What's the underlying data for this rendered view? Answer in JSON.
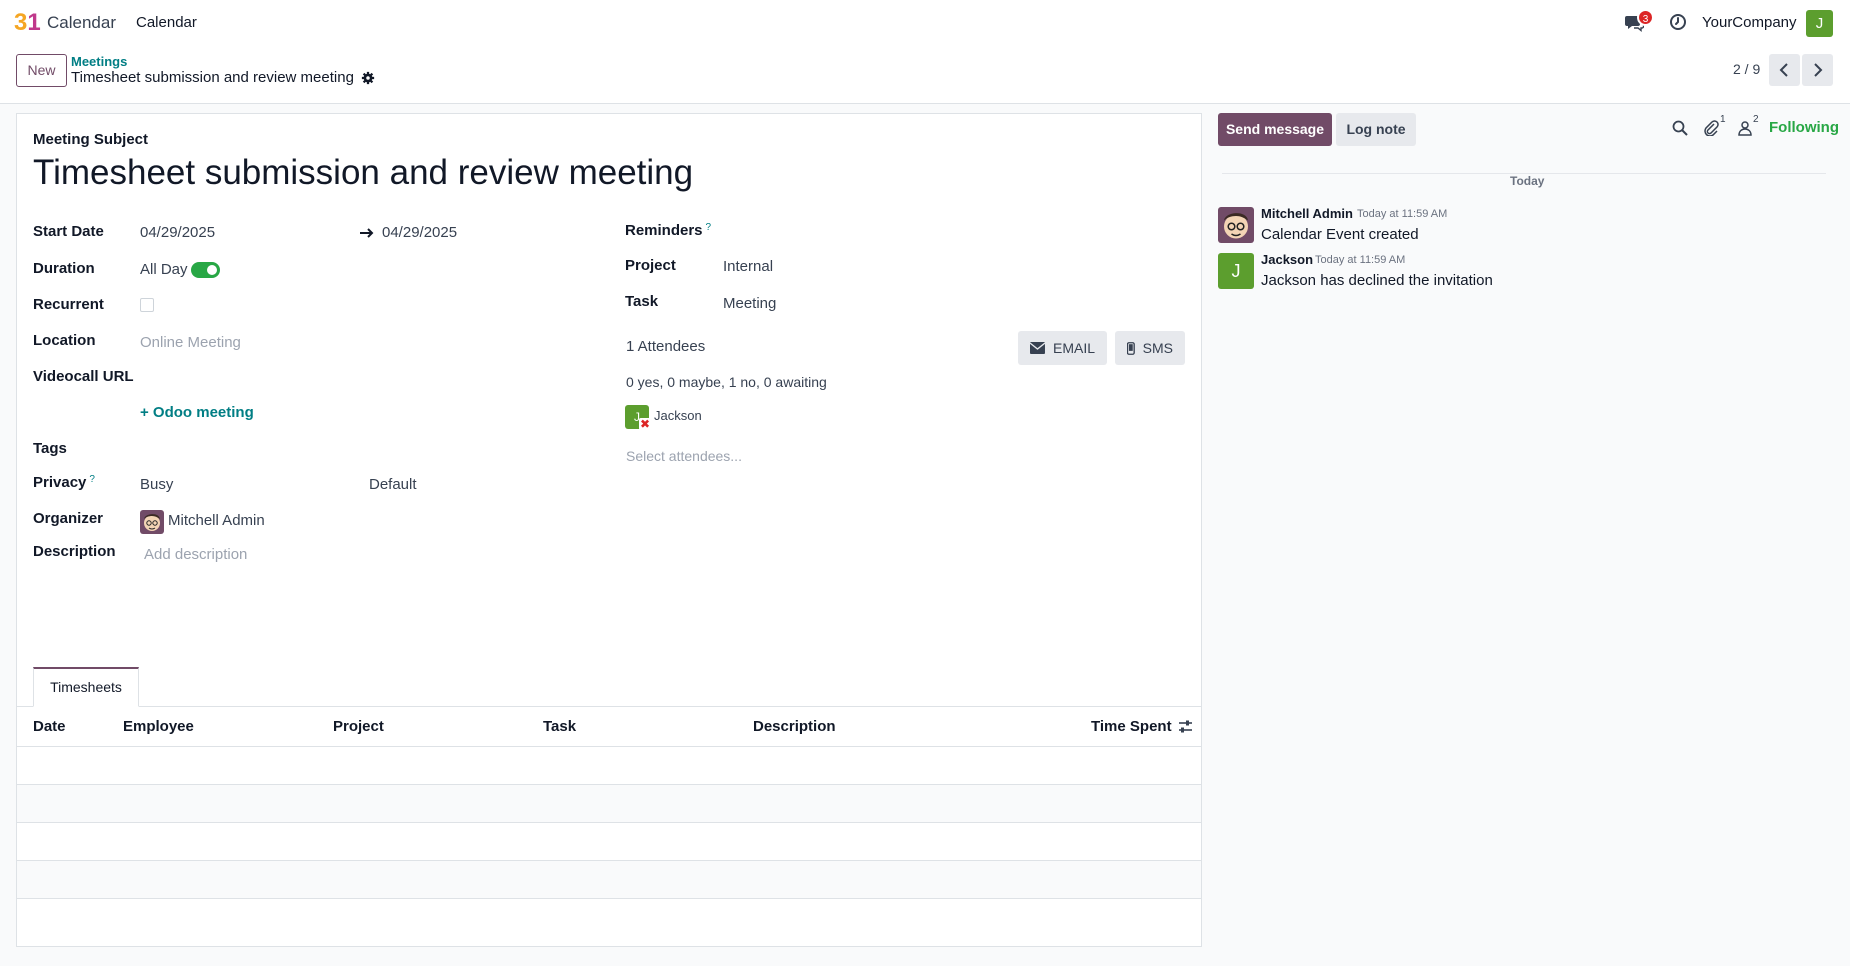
{
  "nav": {
    "app_name": "Calendar",
    "menu_calendar": "Calendar",
    "message_badge": "3",
    "company": "YourCompany",
    "user_initial": "J"
  },
  "control": {
    "new_label": "New",
    "breadcrumb_parent": "Meetings",
    "breadcrumb_current": "Timesheet submission and review meeting",
    "pager": "2 / 9"
  },
  "form": {
    "subject_label": "Meeting Subject",
    "title": "Timesheet submission and review meeting",
    "start_date_label": "Start Date",
    "start_date": "04/29/2025",
    "end_date": "04/29/2025",
    "duration_label": "Duration",
    "all_day_label": "All Day",
    "all_day_checked": true,
    "recurrent_label": "Recurrent",
    "recurrent_checked": false,
    "location_label": "Location",
    "location_placeholder": "Online Meeting",
    "videocall_label": "Videocall URL",
    "odoo_meeting": "+ Odoo meeting",
    "tags_label": "Tags",
    "privacy_label": "Privacy",
    "privacy_help": "?",
    "privacy_value": "Busy",
    "privacy_default": "Default",
    "organizer_label": "Organizer",
    "organizer": "Mitchell Admin",
    "description_label": "Description",
    "description_placeholder": "Add description",
    "reminders_label": "Reminders",
    "reminders_help": "?",
    "project_label": "Project",
    "project": "Internal",
    "task_label": "Task",
    "task": "Meeting",
    "attendees_count": "1 Attendees",
    "email_label": "EMAIL",
    "sms_label": "SMS",
    "attendance_summary": "0 yes, 0 maybe, 1 no, 0 awaiting",
    "attendee_name": "Jackson",
    "attendee_initial": "J",
    "select_attendees_placeholder": "Select attendees..."
  },
  "timesheets": {
    "tab_label": "Timesheets",
    "columns": [
      "Date",
      "Employee",
      "Project",
      "Task",
      "Description",
      "Time Spent"
    ]
  },
  "chatter": {
    "send_message": "Send message",
    "log_note": "Log note",
    "attachments_count": "1",
    "followers_count": "2",
    "following": "Following",
    "today": "Today",
    "messages": [
      {
        "author": "Mitchell Admin",
        "time": "Today at 11:59 AM",
        "body": "Calendar Event created"
      },
      {
        "author": "Jackson",
        "time": "Today at 11:59 AM",
        "body": "Jackson has declined the invitation",
        "initial": "J"
      }
    ]
  },
  "colors": {
    "primary": "#714b67",
    "link": "#017e84",
    "success": "#28a745",
    "avatar_green": "#5c9e2e"
  }
}
